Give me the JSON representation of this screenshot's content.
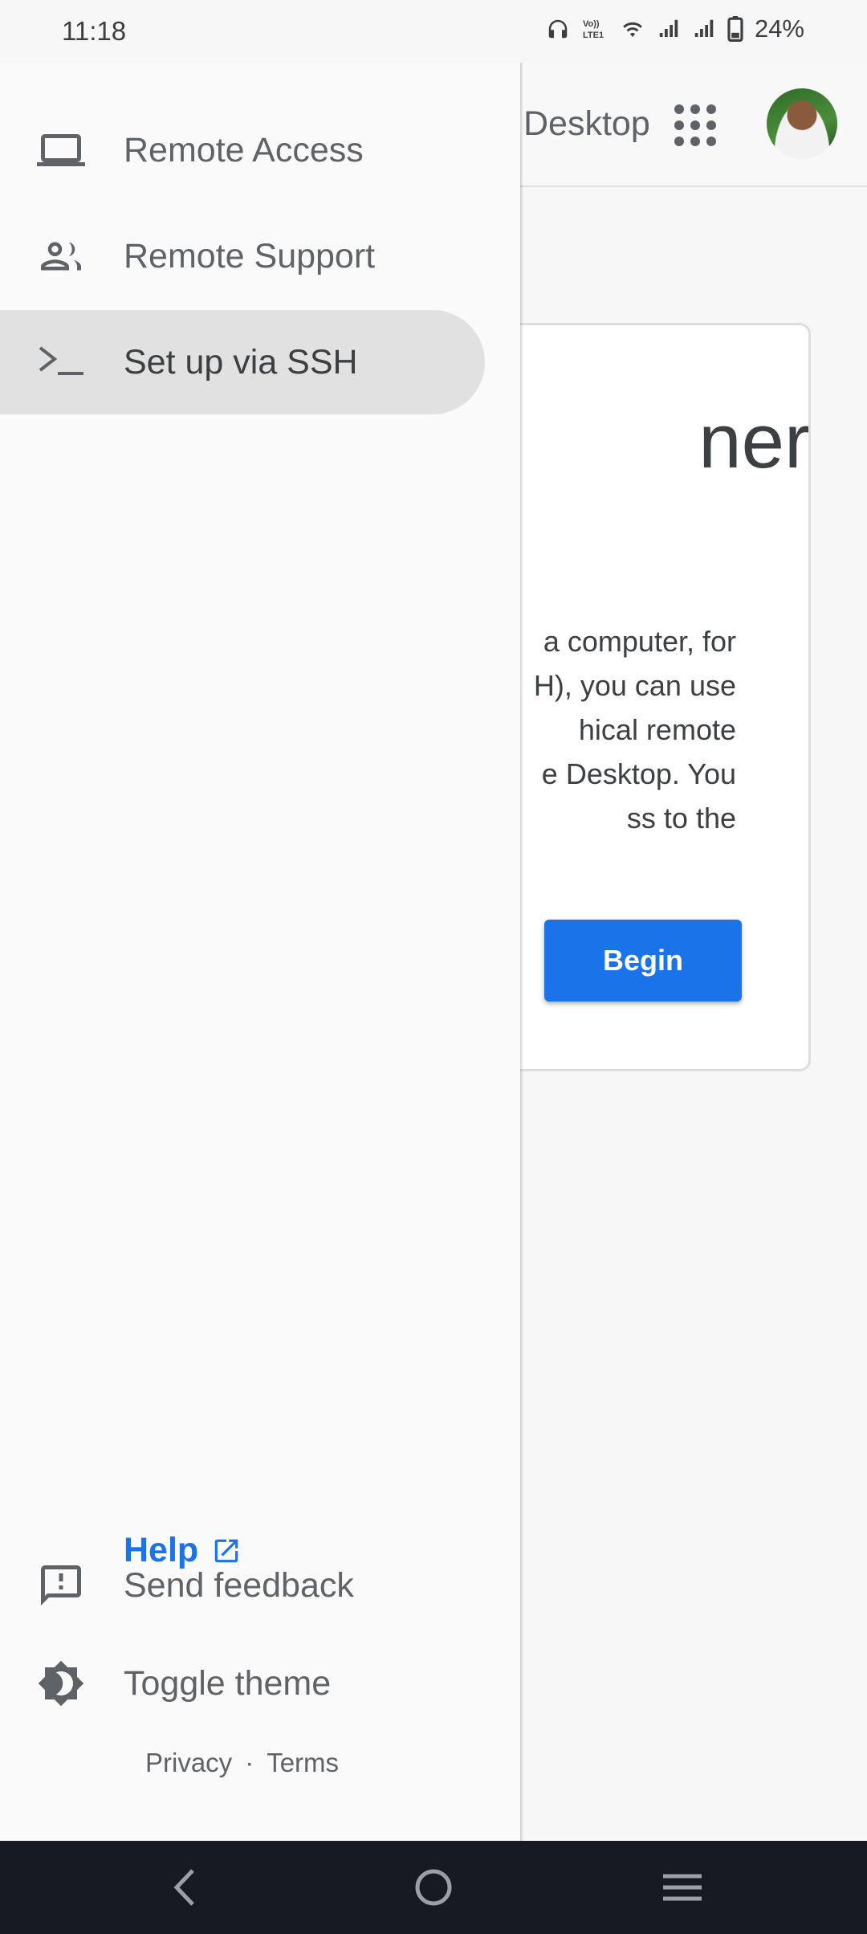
{
  "status_bar": {
    "time": "11:18",
    "battery": "24%"
  },
  "app_header": {
    "title": "Desktop"
  },
  "card": {
    "heading": "ner",
    "body_lines": [
      "a computer, for",
      "H), you can use",
      "hical remote",
      "e Desktop. You",
      "ss to the"
    ],
    "begin_label": "Begin"
  },
  "drawer": {
    "items": [
      {
        "label": "Remote Access",
        "icon": "laptop-icon"
      },
      {
        "label": "Remote Support",
        "icon": "people-icon"
      },
      {
        "label": "Set up via SSH",
        "icon": "terminal-icon",
        "selected": true
      }
    ],
    "help_label": "Help",
    "send_feedback": "Send feedback",
    "toggle_theme": "Toggle theme",
    "privacy": "Privacy",
    "separator": "·",
    "terms": "Terms"
  },
  "colors": {
    "accent": "#1a73e8",
    "drawer_bg": "#fafafa",
    "selected_bg": "#e1e1e1",
    "nav_bar": "#171a22"
  }
}
